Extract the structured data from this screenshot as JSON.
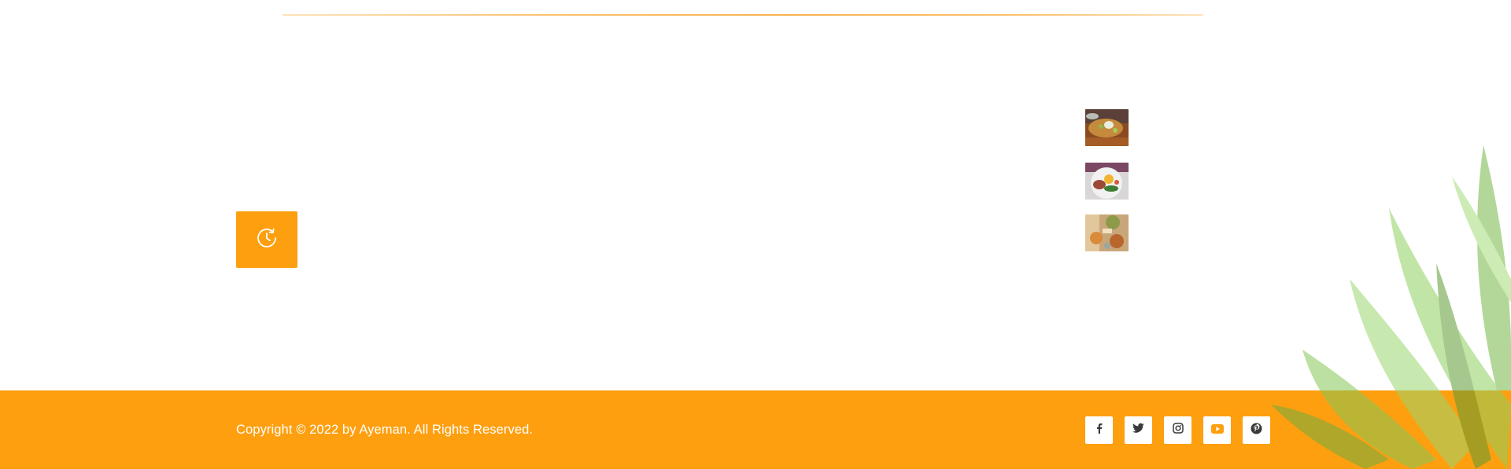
{
  "footer": {
    "copyright": "Copyright © 2022 by Ayeman. All Rights Reserved.",
    "background_color": "#fe9f10"
  },
  "clock_tile": {
    "icon": "clock-history-icon",
    "color": "#fe9f10"
  },
  "recent_post_thumbnails": [
    {
      "icon": "food-photo-thumbnail"
    },
    {
      "icon": "food-photo-thumbnail"
    },
    {
      "icon": "food-photo-thumbnail"
    }
  ],
  "socials": [
    {
      "name": "facebook",
      "icon": "facebook-icon"
    },
    {
      "name": "twitter",
      "icon": "twitter-icon"
    },
    {
      "name": "instagram",
      "icon": "instagram-icon"
    },
    {
      "name": "youtube",
      "icon": "youtube-icon"
    },
    {
      "name": "pinterest",
      "icon": "pinterest-icon"
    }
  ],
  "decoration": {
    "icon": "leaf-plant-decoration",
    "accent_color": "#7cc14f"
  }
}
